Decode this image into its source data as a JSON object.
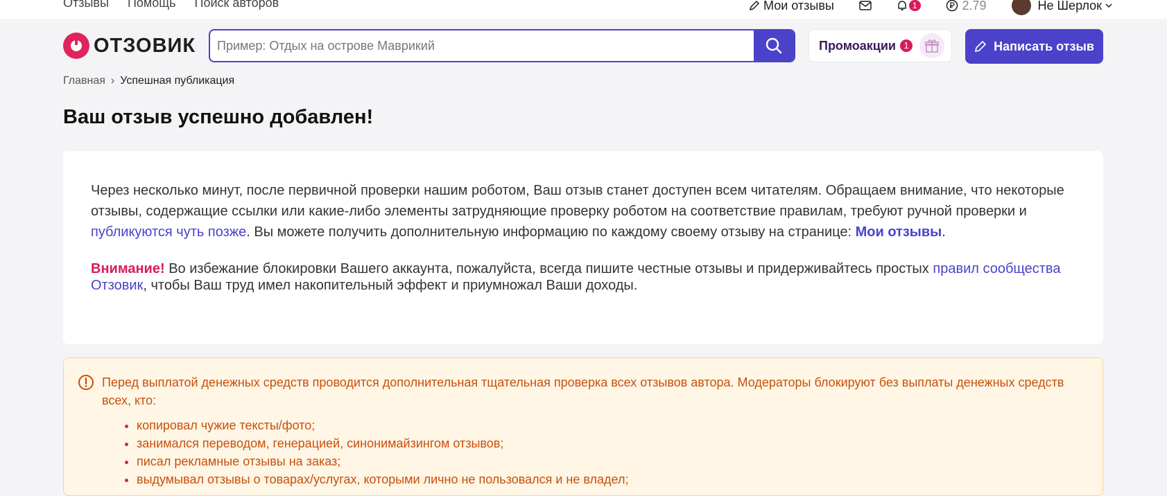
{
  "topbar": {
    "nav": [
      "Отзывы",
      "Помощь",
      "Поиск авторов"
    ],
    "my_reviews": "Мои отзывы",
    "notif_count": "1",
    "balance": "2.79",
    "user_name": "Не Шерлок"
  },
  "header": {
    "logo_text": "ОТЗОВИК",
    "search_placeholder": "Пример: Отдых на острове Маврикий",
    "promo_label": "Промоакции",
    "promo_count": "1",
    "write_label": "Написать отзыв"
  },
  "breadcrumb": {
    "home": "Главная",
    "separator": "›",
    "current": "Успешная публикация"
  },
  "page_title": "Ваш отзыв успешно добавлен!",
  "card": {
    "p1_before": "Через несколько минут, после первичной проверки нашим роботом, Ваш отзыв станет доступен всем читателям. Обращаем внимание, что некоторые отзывы, содержащие ссылки или какие-либо элементы затрудняющие проверку роботом на соответствие правилам, требуют ручной проверки и ",
    "p1_link": "публикуются чуть позже",
    "p1_after": ". Вы можете получить дополнительную информацию по каждому своему отзыву на странице: ",
    "p1_link2": "Мои отзывы",
    "p1_end": ".",
    "p2_warn": "Внимание!",
    "p2_before": " Во избежание блокировки Вашего аккаунта, пожалуйста, всегда пишите честные отзывы и придерживайтесь простых ",
    "p2_link": "правил сообщества Отзовик",
    "p2_after": ", чтобы Ваш труд имел накопительный эффект и приумножал Ваши доходы."
  },
  "alert": {
    "text": "Перед выплатой денежных средств проводится дополнительная тщательная проверка всех отзывов автора. Модераторы блокируют без выплаты денежных средств всех, кто:",
    "items": [
      "копировал чужие тексты/фото;",
      "занимался переводом, генерацией, синонимайзингом отзывов;",
      "писал рекламные отзывы на заказ;",
      "выдумывал отзывы о товарах/услугах, которыми лично не пользовался и не владел;"
    ]
  },
  "colors": {
    "accent": "#4a42c9",
    "brand": "#e0245e",
    "warning_text": "#c8500a",
    "warning_bg": "#fff6e6"
  }
}
